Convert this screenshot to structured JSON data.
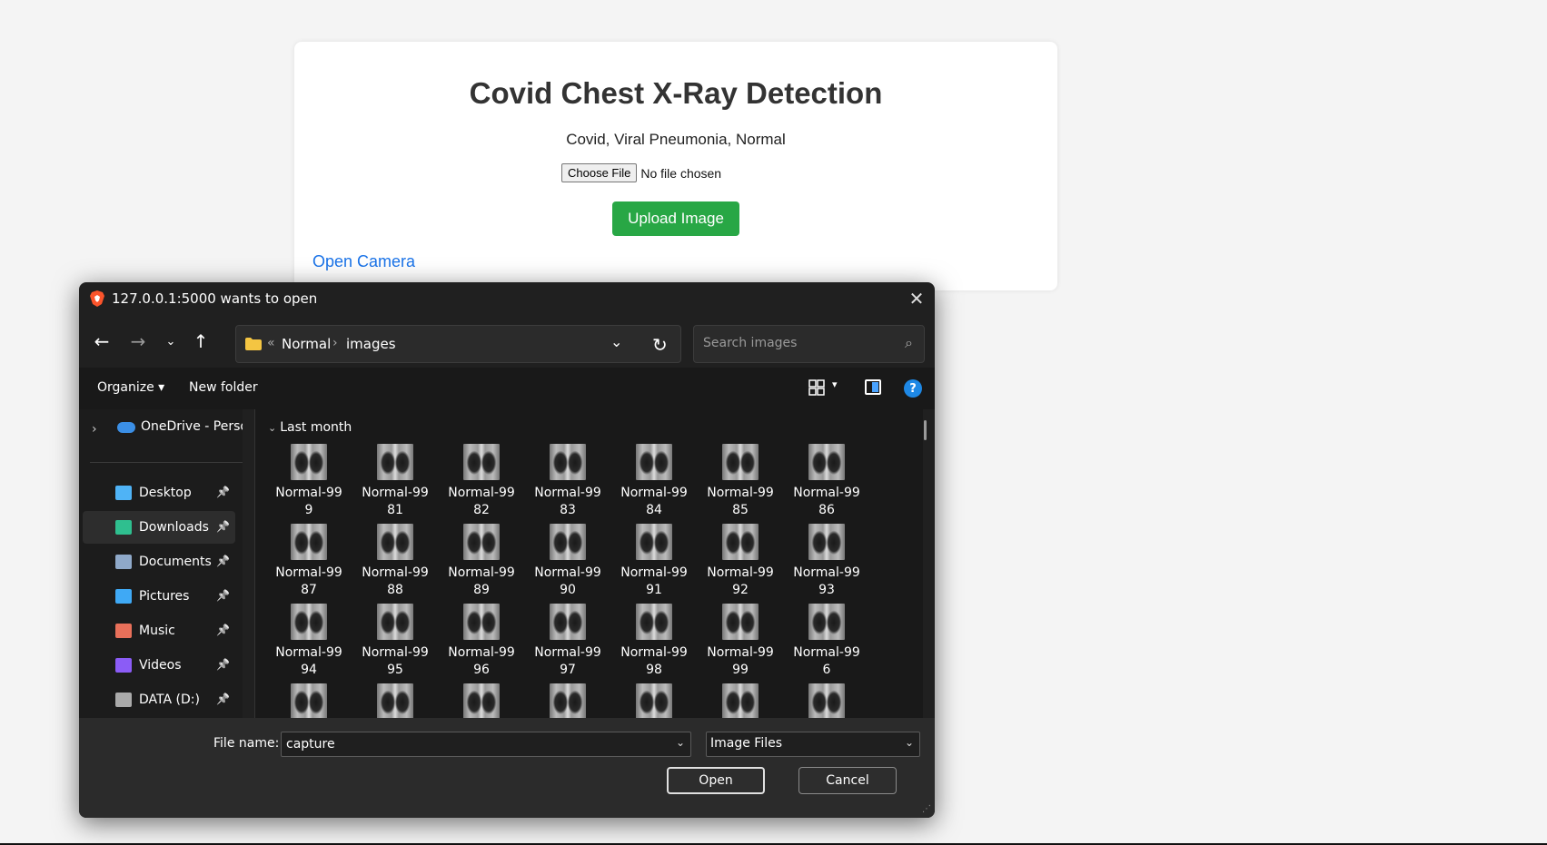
{
  "page": {
    "title": "Covid Chest X-Ray Detection",
    "subtitle": "Covid, Viral Pneumonia, Normal",
    "choose_file_label": "Choose File",
    "no_file_text": "No file chosen",
    "upload_label": "Upload Image",
    "open_camera_label": "Open Camera"
  },
  "dialog": {
    "title": "127.0.0.1:5000 wants to open",
    "breadcrumb": {
      "overflow": "«",
      "items": [
        "Normal",
        "images"
      ],
      "separator": "›"
    },
    "search_placeholder": "Search images",
    "toolbar": {
      "organize_label": "Organize ▾",
      "new_folder_label": "New folder"
    },
    "sidebar": {
      "onedrive_label": "OneDrive - Perso",
      "items": [
        {
          "label": "Desktop",
          "icon": "desktop-icon",
          "color": "#4fb3f6"
        },
        {
          "label": "Downloads",
          "icon": "download-icon",
          "color": "#2fbf8f"
        },
        {
          "label": "Documents",
          "icon": "documents-icon",
          "color": "#8fa9c9"
        },
        {
          "label": "Pictures",
          "icon": "pictures-icon",
          "color": "#3fa9f5"
        },
        {
          "label": "Music",
          "icon": "music-icon",
          "color": "#e8705a"
        },
        {
          "label": "Videos",
          "icon": "videos-icon",
          "color": "#8b5cf6"
        },
        {
          "label": "DATA (D:)",
          "icon": "drive-icon",
          "color": "#aaaaaa"
        }
      ]
    },
    "group_header": "Last month",
    "files": [
      {
        "line1": "Normal-99",
        "line2": "9"
      },
      {
        "line1": "Normal-99",
        "line2": "81"
      },
      {
        "line1": "Normal-99",
        "line2": "82"
      },
      {
        "line1": "Normal-99",
        "line2": "83"
      },
      {
        "line1": "Normal-99",
        "line2": "84"
      },
      {
        "line1": "Normal-99",
        "line2": "85"
      },
      {
        "line1": "Normal-99",
        "line2": "86"
      },
      {
        "line1": "Normal-99",
        "line2": "87"
      },
      {
        "line1": "Normal-99",
        "line2": "88"
      },
      {
        "line1": "Normal-99",
        "line2": "89"
      },
      {
        "line1": "Normal-99",
        "line2": "90"
      },
      {
        "line1": "Normal-99",
        "line2": "91"
      },
      {
        "line1": "Normal-99",
        "line2": "92"
      },
      {
        "line1": "Normal-99",
        "line2": "93"
      },
      {
        "line1": "Normal-99",
        "line2": "94"
      },
      {
        "line1": "Normal-99",
        "line2": "95"
      },
      {
        "line1": "Normal-99",
        "line2": "96"
      },
      {
        "line1": "Normal-99",
        "line2": "97"
      },
      {
        "line1": "Normal-99",
        "line2": "98"
      },
      {
        "line1": "Normal-99",
        "line2": "99"
      },
      {
        "line1": "Normal-99",
        "line2": "6"
      },
      {
        "line1": "",
        "line2": ""
      },
      {
        "line1": "",
        "line2": ""
      },
      {
        "line1": "",
        "line2": ""
      },
      {
        "line1": "",
        "line2": ""
      },
      {
        "line1": "",
        "line2": ""
      },
      {
        "line1": "",
        "line2": ""
      },
      {
        "line1": "",
        "line2": ""
      }
    ],
    "footer": {
      "file_name_label": "File name:",
      "file_name_value": "capture",
      "file_type_value": "Image Files",
      "open_label": "Open",
      "cancel_label": "Cancel"
    }
  },
  "colors": {
    "upload_green": "#28a745",
    "link_blue": "#1a73e8",
    "dialog_bg": "#202020"
  }
}
